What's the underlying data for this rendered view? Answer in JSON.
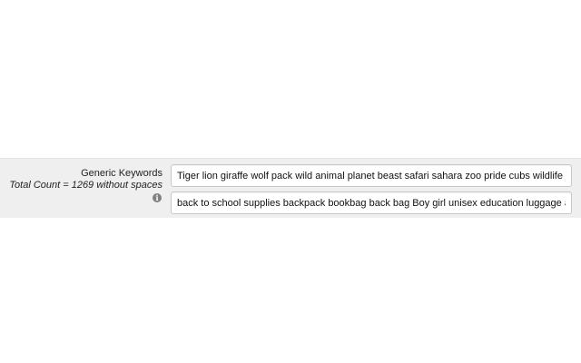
{
  "keywords_row": {
    "label": "Generic Keywords",
    "total_count": "Total Count = 1269 without spaces",
    "info_icon": "info-icon",
    "info_glyph": "i",
    "field_1_value": "Tiger lion giraffe wolf pack wild animal planet beast safari sahara zoo pride cubs wildlife ju",
    "field_2_value": "back to school supplies backpack bookbag back bag Boy girl unisex education luggage ac"
  },
  "colors": {
    "row_background": "#efefef",
    "field_border": "#c8c8c8",
    "icon": "#808080"
  }
}
